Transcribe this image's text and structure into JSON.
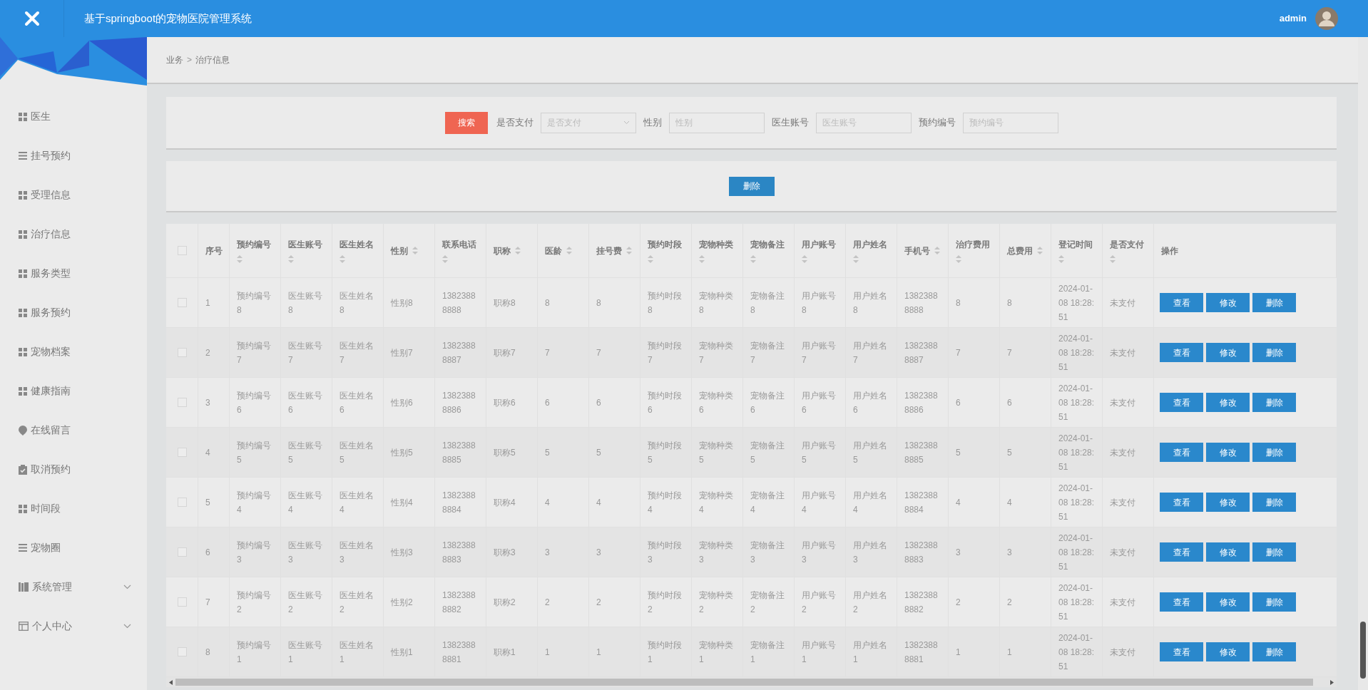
{
  "header": {
    "title": "基于springboot的宠物医院管理系统",
    "user": "admin"
  },
  "sidebar": {
    "items": [
      {
        "label": "医生",
        "kind": "grid"
      },
      {
        "label": "挂号预约",
        "kind": "list"
      },
      {
        "label": "受理信息",
        "kind": "grid"
      },
      {
        "label": "治疗信息",
        "kind": "grid"
      },
      {
        "label": "服务类型",
        "kind": "grid"
      },
      {
        "label": "服务预约",
        "kind": "grid"
      },
      {
        "label": "宠物档案",
        "kind": "grid"
      },
      {
        "label": "健康指南",
        "kind": "grid"
      },
      {
        "label": "在线留言",
        "kind": "pin"
      },
      {
        "label": "取消预约",
        "kind": "clipboard"
      },
      {
        "label": "时间段",
        "kind": "grid"
      },
      {
        "label": "宠物圈",
        "kind": "list"
      },
      {
        "label": "系统管理",
        "kind": "book"
      },
      {
        "label": "个人中心",
        "kind": "window"
      }
    ]
  },
  "breadcrumb": {
    "items": [
      "业务",
      "治疗信息"
    ],
    "separator": ">"
  },
  "search": {
    "button": "搜索",
    "fields": [
      {
        "label": "是否支付",
        "placeholder": "是否支付",
        "kind": "select"
      },
      {
        "label": "性别",
        "placeholder": "性别",
        "kind": "text"
      },
      {
        "label": "医生账号",
        "placeholder": "医生账号",
        "kind": "text"
      },
      {
        "label": "预约编号",
        "placeholder": "预约编号",
        "kind": "text"
      }
    ]
  },
  "toolbar": {
    "buttons": [
      "删除"
    ]
  },
  "table": {
    "select_all": {
      "checked": false
    },
    "columns": [
      {
        "label": "序号",
        "sortable": false
      },
      {
        "label": "预约编号",
        "sortable": true
      },
      {
        "label": "医生账号",
        "sortable": true
      },
      {
        "label": "医生姓名",
        "sortable": true
      },
      {
        "label": "性别",
        "sortable": true
      },
      {
        "label": "联系电话",
        "sortable": true
      },
      {
        "label": "职称",
        "sortable": true
      },
      {
        "label": "医龄",
        "sortable": true
      },
      {
        "label": "挂号费",
        "sortable": true
      },
      {
        "label": "预约时段",
        "sortable": true
      },
      {
        "label": "宠物种类",
        "sortable": true
      },
      {
        "label": "宠物备注",
        "sortable": true
      },
      {
        "label": "用户账号",
        "sortable": true
      },
      {
        "label": "用户姓名",
        "sortable": true
      },
      {
        "label": "手机号",
        "sortable": true
      },
      {
        "label": "治疗费用",
        "sortable": true
      },
      {
        "label": "总费用",
        "sortable": true
      },
      {
        "label": "登记时间",
        "sortable": true
      },
      {
        "label": "是否支付",
        "sortable": true
      },
      {
        "label": "操作",
        "sortable": false
      }
    ],
    "rows": [
      {
        "checked": false,
        "cells": [
          "1",
          "预约编号8",
          "医生账号8",
          "医生姓名8",
          "性别8",
          "13823888888",
          "职称8",
          "8",
          "8",
          "预约时段8",
          "宠物种类8",
          "宠物备注8",
          "用户账号8",
          "用户姓名8",
          "13823888888",
          "8",
          "8",
          "2024-01-08 18:28:51",
          "未支付"
        ],
        "actions": [
          "查看",
          "修改",
          "删除"
        ]
      },
      {
        "checked": false,
        "cells": [
          "2",
          "预约编号7",
          "医生账号7",
          "医生姓名7",
          "性别7",
          "13823888887",
          "职称7",
          "7",
          "7",
          "预约时段7",
          "宠物种类7",
          "宠物备注7",
          "用户账号7",
          "用户姓名7",
          "13823888887",
          "7",
          "7",
          "2024-01-08 18:28:51",
          "未支付"
        ],
        "actions": [
          "查看",
          "修改",
          "删除"
        ]
      },
      {
        "checked": false,
        "cells": [
          "3",
          "预约编号6",
          "医生账号6",
          "医生姓名6",
          "性别6",
          "13823888886",
          "职称6",
          "6",
          "6",
          "预约时段6",
          "宠物种类6",
          "宠物备注6",
          "用户账号6",
          "用户姓名6",
          "13823888886",
          "6",
          "6",
          "2024-01-08 18:28:51",
          "未支付"
        ],
        "actions": [
          "查看",
          "修改",
          "删除"
        ]
      },
      {
        "checked": false,
        "cells": [
          "4",
          "预约编号5",
          "医生账号5",
          "医生姓名5",
          "性别5",
          "13823888885",
          "职称5",
          "5",
          "5",
          "预约时段5",
          "宠物种类5",
          "宠物备注5",
          "用户账号5",
          "用户姓名5",
          "13823888885",
          "5",
          "5",
          "2024-01-08 18:28:51",
          "未支付"
        ],
        "actions": [
          "查看",
          "修改",
          "删除"
        ]
      },
      {
        "checked": false,
        "cells": [
          "5",
          "预约编号4",
          "医生账号4",
          "医生姓名4",
          "性别4",
          "13823888884",
          "职称4",
          "4",
          "4",
          "预约时段4",
          "宠物种类4",
          "宠物备注4",
          "用户账号4",
          "用户姓名4",
          "13823888884",
          "4",
          "4",
          "2024-01-08 18:28:51",
          "未支付"
        ],
        "actions": [
          "查看",
          "修改",
          "删除"
        ]
      },
      {
        "checked": false,
        "cells": [
          "6",
          "预约编号3",
          "医生账号3",
          "医生姓名3",
          "性别3",
          "13823888883",
          "职称3",
          "3",
          "3",
          "预约时段3",
          "宠物种类3",
          "宠物备注3",
          "用户账号3",
          "用户姓名3",
          "13823888883",
          "3",
          "3",
          "2024-01-08 18:28:51",
          "未支付"
        ],
        "actions": [
          "查看",
          "修改",
          "删除"
        ]
      },
      {
        "checked": false,
        "cells": [
          "7",
          "预约编号2",
          "医生账号2",
          "医生姓名2",
          "性别2",
          "13823888882",
          "职称2",
          "2",
          "2",
          "预约时段2",
          "宠物种类2",
          "宠物备注2",
          "用户账号2",
          "用户姓名2",
          "13823888882",
          "2",
          "2",
          "2024-01-08 18:28:51",
          "未支付"
        ],
        "actions": [
          "查看",
          "修改",
          "删除"
        ]
      },
      {
        "checked": false,
        "cells": [
          "8",
          "预约编号1",
          "医生账号1",
          "医生姓名1",
          "性别1",
          "13823888881",
          "职称1",
          "1",
          "1",
          "预约时段1",
          "宠物种类1",
          "宠物备注1",
          "用户账号1",
          "用户姓名1",
          "13823888881",
          "1",
          "1",
          "2024-01-08 18:28:51",
          "未支付"
        ],
        "actions": [
          "查看",
          "修改",
          "删除"
        ]
      }
    ]
  }
}
